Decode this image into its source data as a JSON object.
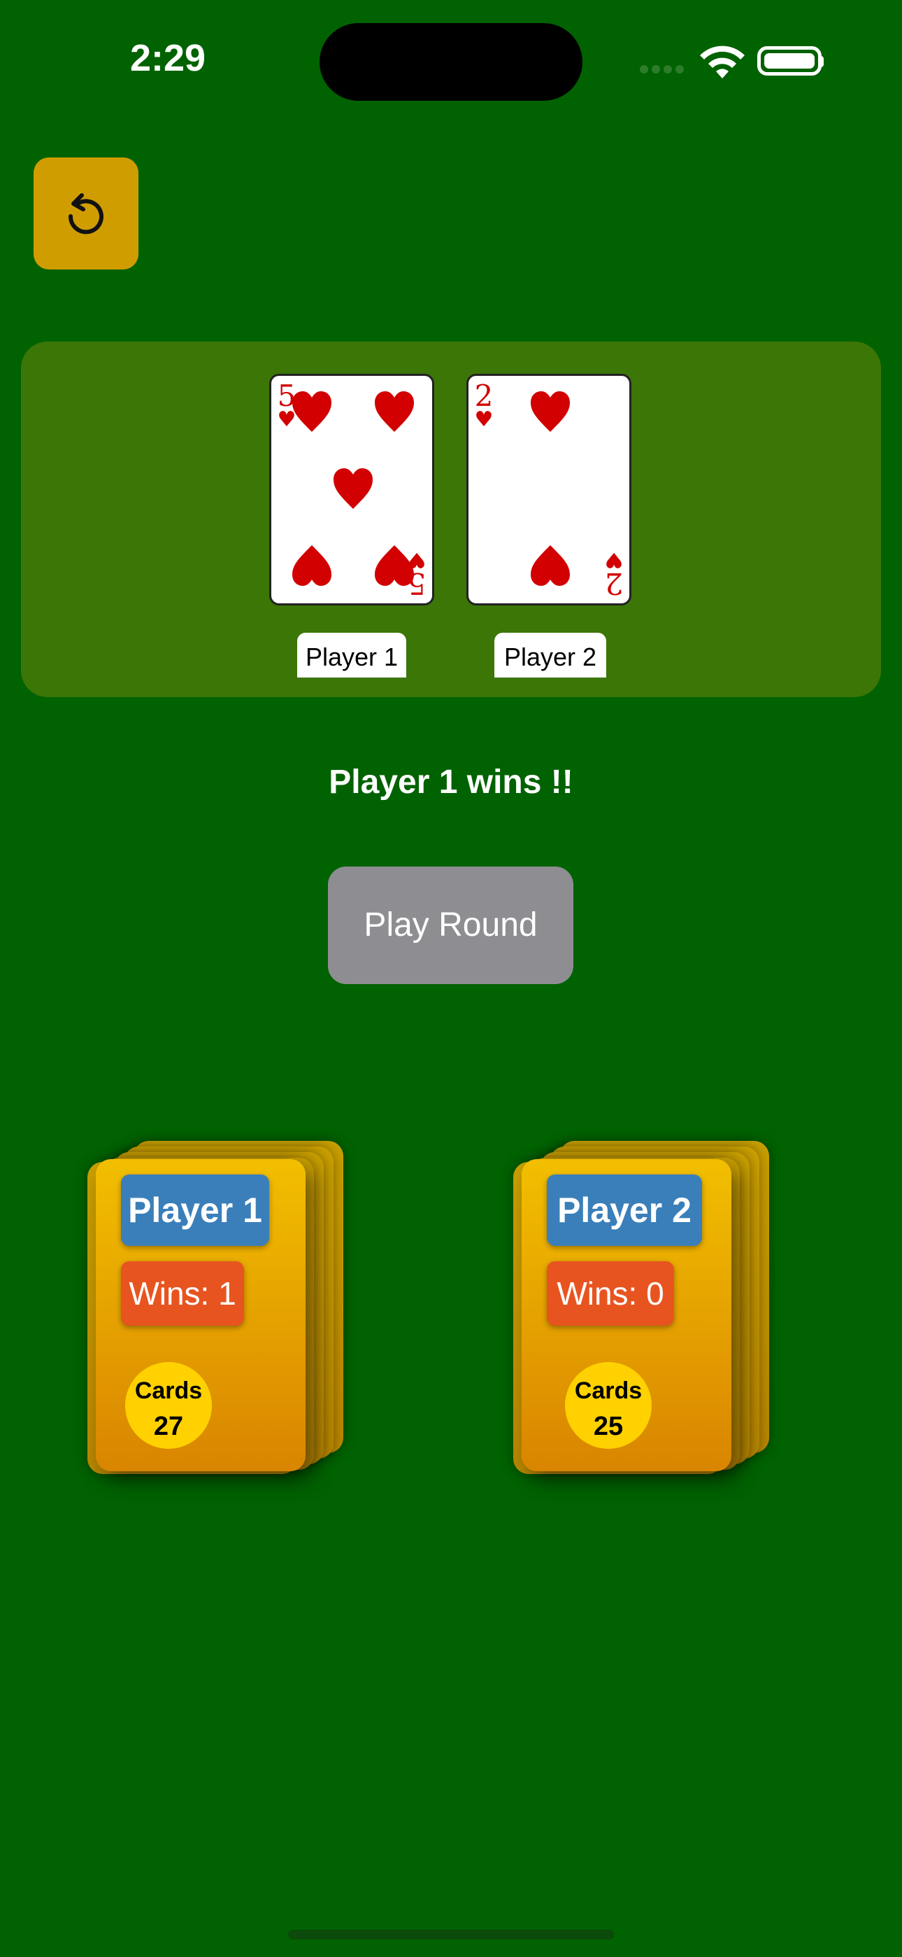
{
  "status_bar": {
    "time": "2:29",
    "icons": [
      "cellular-signal-icon",
      "wifi-icon",
      "battery-icon"
    ]
  },
  "toolbar": {
    "reset_icon": "undo-arrow-icon"
  },
  "table": {
    "cards": [
      {
        "rank": "5",
        "suit": "hearts",
        "suit_symbol": "♥",
        "color": "#d20000",
        "player_label": "Player 1"
      },
      {
        "rank": "2",
        "suit": "hearts",
        "suit_symbol": "♥",
        "color": "#d20000",
        "player_label": "Player 2"
      }
    ]
  },
  "result_text": "Player 1 wins !!",
  "play_button": {
    "label": "Play Round"
  },
  "decks": [
    {
      "player": "Player 1",
      "wins": "Wins: 1",
      "cards_label": "Cards",
      "cards_count": "27"
    },
    {
      "player": "Player 2",
      "wins": "Wins: 0",
      "cards_label": "Cards",
      "cards_count": "25"
    }
  ],
  "colors": {
    "felt": "#016201",
    "table_area": "#3b7607",
    "reset_button": "#d09d00",
    "play_button": "#8e8e92",
    "player_name_badge": "#3a7fba",
    "wins_badge": "#e85420",
    "cards_circle": "#ffd100"
  }
}
